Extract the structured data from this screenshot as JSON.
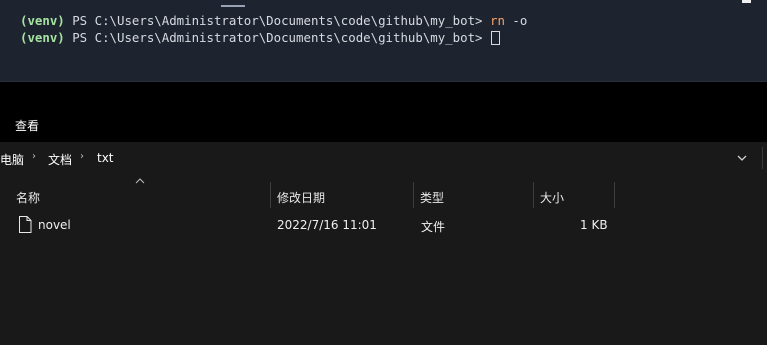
{
  "terminal": {
    "lines": [
      {
        "venv": "(venv)",
        "prompt": " PS C:\\Users\\Administrator\\Documents\\code\\github\\my_bot> ",
        "command": "rn",
        "args": " -o"
      },
      {
        "venv": "(venv)",
        "prompt": " PS C:\\Users\\Administrator\\Documents\\code\\github\\my_bot> "
      }
    ]
  },
  "explorer": {
    "ribbon": {
      "view_label": "查看"
    },
    "breadcrumb": [
      "电脑",
      "文档",
      "txt"
    ],
    "columns": {
      "name": "名称",
      "date": "修改日期",
      "type": "类型",
      "size": "大小"
    },
    "files": [
      {
        "name": "novel",
        "date": "2022/7/16 11:01",
        "type": "文件",
        "size": "1 KB",
        "icon": "file-icon"
      }
    ]
  },
  "colors": {
    "terminal_bg": "#1e2330",
    "venv": "#a6e3a1",
    "command": "#f5a36a",
    "explorer_bg": "#191919"
  }
}
